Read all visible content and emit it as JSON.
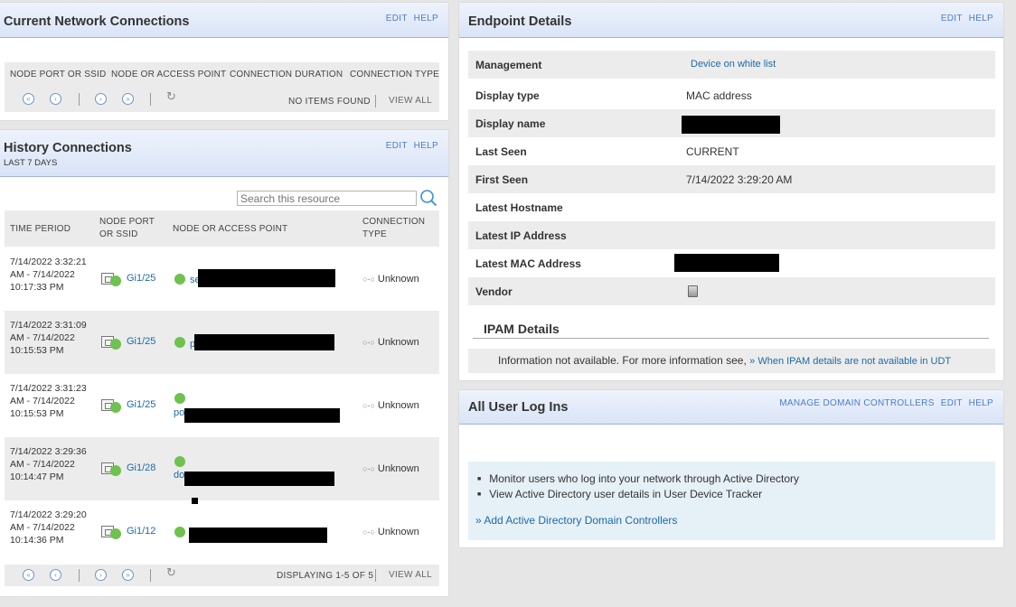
{
  "panel_actions": {
    "edit": "EDIT",
    "help": "HELP",
    "manage_dc": "MANAGE DOMAIN CONTROLLERS"
  },
  "current_connections": {
    "title": "Current Network Connections",
    "columns": [
      "NODE PORT OR SSID",
      "NODE OR ACCESS POINT",
      "CONNECTION DURATION",
      "CONNECTION TYPE"
    ],
    "status": "NO ITEMS FOUND",
    "view_all": "VIEW ALL"
  },
  "pager_icons": {
    "first": "«",
    "prev": "‹",
    "next": "›",
    "last": "»",
    "refresh": "↻"
  },
  "history": {
    "title": "History Connections",
    "subtitle": "LAST 7 DAYS",
    "search_placeholder": "Search this resource",
    "columns": {
      "time": "TIME PERIOD",
      "port": "NODE PORT OR SSID",
      "node": "NODE OR ACCESS POINT",
      "type": "CONNECTION TYPE"
    },
    "rows": [
      {
        "time": "7/14/2022 3:32:21 AM - 7/14/2022 10:17:33 PM",
        "port": "Gi1/25",
        "node_fragment": "se",
        "type": "Unknown"
      },
      {
        "time": "7/14/2022 3:31:09 AM - 7/14/2022 10:15:53 PM",
        "port": "Gi1/25",
        "node_fragment": "p",
        "type": "Unknown"
      },
      {
        "time": "7/14/2022 3:31:23 AM - 7/14/2022 10:15:53 PM",
        "port": "Gi1/25",
        "node_fragment": "po",
        "type": "Unknown"
      },
      {
        "time": "7/14/2022 3:29:36 AM - 7/14/2022 10:14:47 PM",
        "port": "Gi1/28",
        "node_fragment": "do",
        "type": "Unknown"
      },
      {
        "time": "7/14/2022 3:29:20 AM - 7/14/2022 10:14:36 PM",
        "port": "Gi1/12",
        "node_fragment": "",
        "type": "Unknown"
      }
    ],
    "status": "DISPLAYING 1-5 OF 5",
    "view_all": "VIEW ALL"
  },
  "endpoint": {
    "title": "Endpoint Details",
    "rows": [
      {
        "label": "Management",
        "value": "Device on white list"
      },
      {
        "label": "Display type",
        "value": "MAC address"
      },
      {
        "label": "Display name",
        "value": ""
      },
      {
        "label": "Last Seen",
        "value": "CURRENT"
      },
      {
        "label": "First Seen",
        "value": "7/14/2022 3:29:20 AM"
      },
      {
        "label": "Latest Hostname",
        "value": ""
      },
      {
        "label": "Latest IP Address",
        "value": ""
      },
      {
        "label": "Latest MAC Address",
        "value": ""
      },
      {
        "label": "Vendor",
        "value": ""
      }
    ],
    "ipam_title": "IPAM Details",
    "ipam_text": "Information not available. For more information see,",
    "ipam_link": "» When IPAM details are not available in UDT"
  },
  "user_logins": {
    "title": "All User Log Ins",
    "bullets": [
      "Monitor users who log into your network through Active Directory",
      "View Active Directory user details in User Device Tracker"
    ],
    "add_link": "»  Add Active Directory Domain Controllers"
  }
}
